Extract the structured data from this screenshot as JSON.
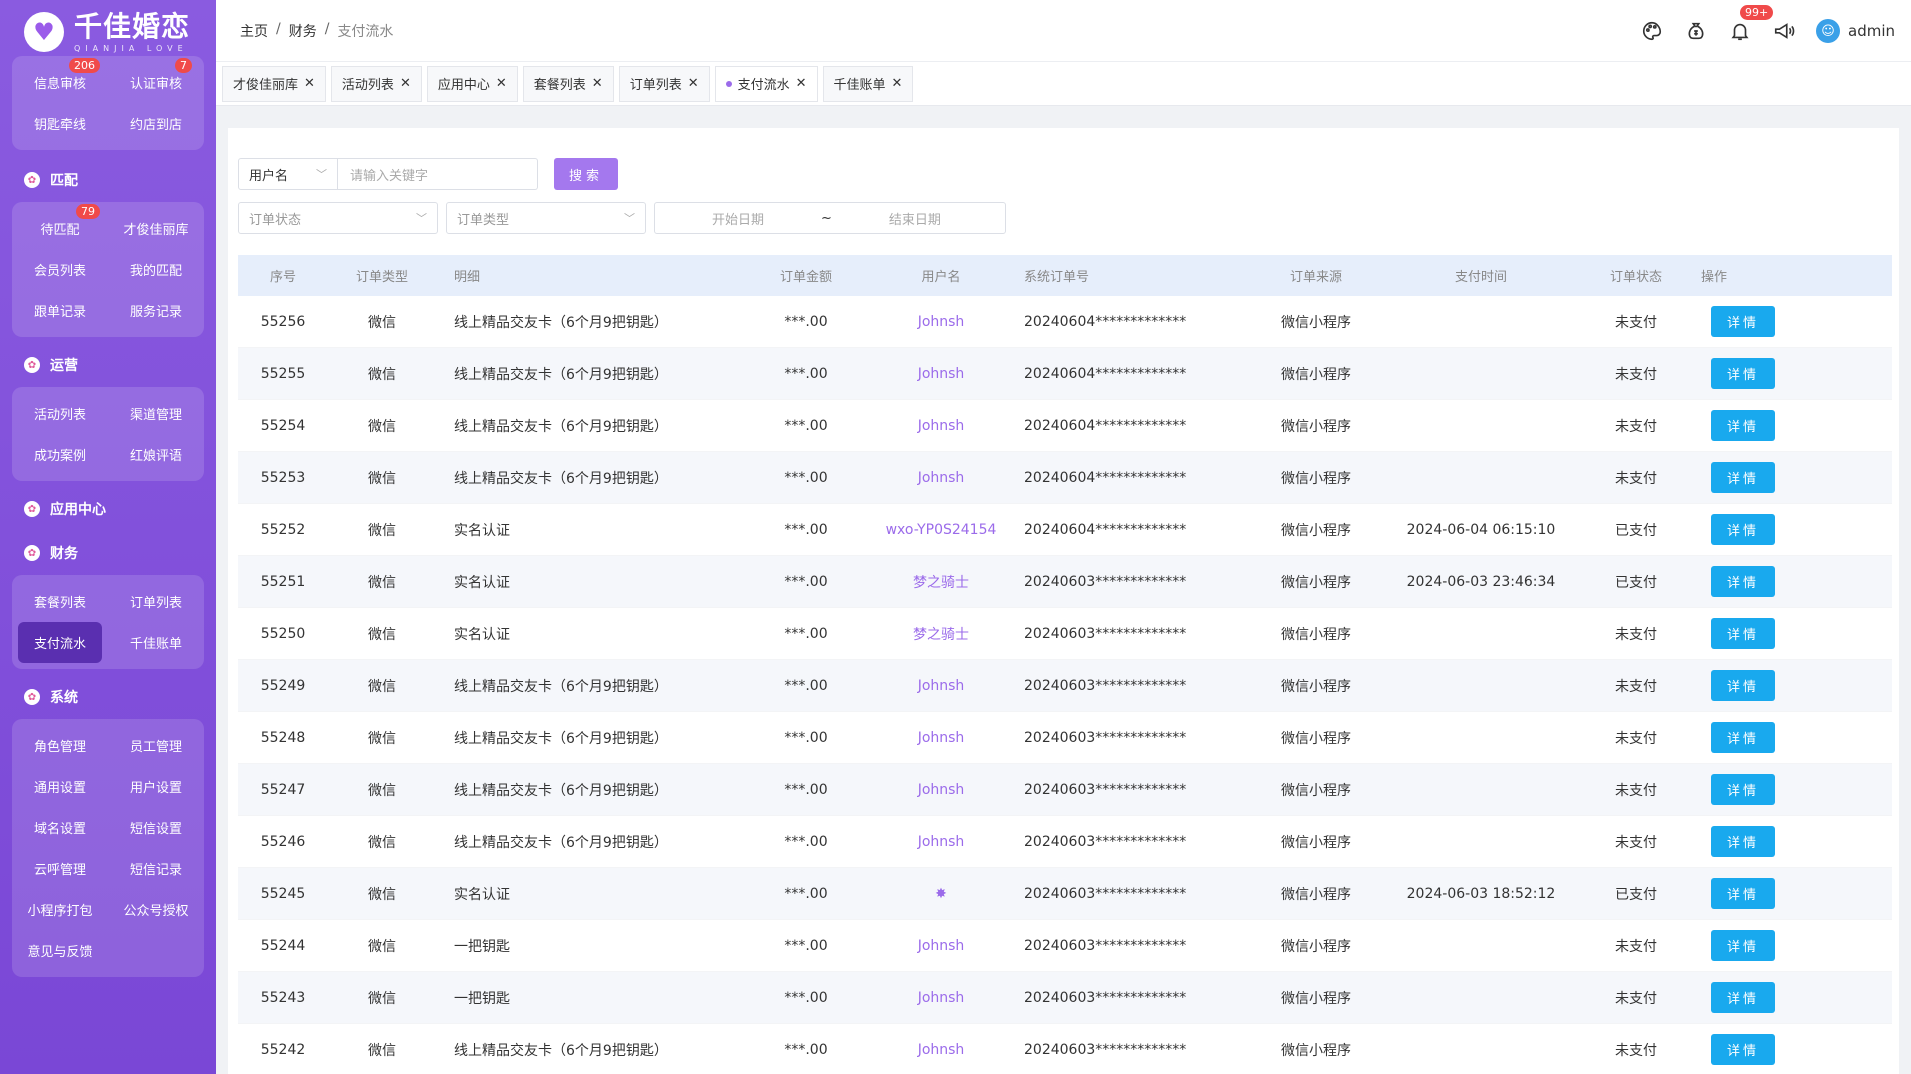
{
  "brand": {
    "name": "千佳婚恋",
    "sub": "QIANJIA LOVE"
  },
  "sidebar": {
    "top_group": [
      {
        "label": "信息审核",
        "badge": "206"
      },
      {
        "label": "认证审核",
        "badge": "7"
      },
      {
        "label": "钥匙牵线",
        "badge": ""
      },
      {
        "label": "约店到店",
        "badge": ""
      }
    ],
    "sections": [
      {
        "title": "匹配",
        "items": [
          {
            "label": "待匹配",
            "badge": "79"
          },
          {
            "label": "才俊佳丽库",
            "badge": ""
          },
          {
            "label": "会员列表",
            "badge": ""
          },
          {
            "label": "我的匹配",
            "badge": ""
          },
          {
            "label": "跟单记录",
            "badge": ""
          },
          {
            "label": "服务记录",
            "badge": ""
          }
        ]
      },
      {
        "title": "运营",
        "items": [
          {
            "label": "活动列表",
            "badge": ""
          },
          {
            "label": "渠道管理",
            "badge": ""
          },
          {
            "label": "成功案例",
            "badge": ""
          },
          {
            "label": "红娘评语",
            "badge": ""
          }
        ]
      },
      {
        "title": "应用中心",
        "items": []
      },
      {
        "title": "财务",
        "items": [
          {
            "label": "套餐列表",
            "badge": ""
          },
          {
            "label": "订单列表",
            "badge": ""
          },
          {
            "label": "支付流水",
            "badge": "",
            "active": true
          },
          {
            "label": "千佳账单",
            "badge": ""
          }
        ]
      },
      {
        "title": "系统",
        "items": [
          {
            "label": "角色管理",
            "badge": ""
          },
          {
            "label": "员工管理",
            "badge": ""
          },
          {
            "label": "通用设置",
            "badge": ""
          },
          {
            "label": "用户设置",
            "badge": ""
          },
          {
            "label": "域名设置",
            "badge": ""
          },
          {
            "label": "短信设置",
            "badge": ""
          },
          {
            "label": "云呼管理",
            "badge": ""
          },
          {
            "label": "短信记录",
            "badge": ""
          },
          {
            "label": "小程序打包",
            "badge": ""
          },
          {
            "label": "公众号授权",
            "badge": ""
          },
          {
            "label": "意见与反馈",
            "badge": ""
          }
        ]
      }
    ]
  },
  "header": {
    "breadcrumb": [
      "主页",
      "财务",
      "支付流水"
    ],
    "bell_badge": "99+",
    "user": "admin"
  },
  "tabs": [
    {
      "label": "才俊佳丽库",
      "active": false
    },
    {
      "label": "活动列表",
      "active": false
    },
    {
      "label": "应用中心",
      "active": false
    },
    {
      "label": "套餐列表",
      "active": false
    },
    {
      "label": "订单列表",
      "active": false
    },
    {
      "label": "支付流水",
      "active": true
    },
    {
      "label": "千佳账单",
      "active": false
    }
  ],
  "filters": {
    "field_select": "用户名",
    "keyword_placeholder": "请输入关键字",
    "search_label": "搜索",
    "status_placeholder": "订单状态",
    "type_placeholder": "订单类型",
    "start_date": "开始日期",
    "date_sep": "~",
    "end_date": "结束日期"
  },
  "table": {
    "columns": [
      "序号",
      "订单类型",
      "明细",
      "订单金额",
      "用户名",
      "系统订单号",
      "订单来源",
      "支付时间",
      "订单状态",
      "操作"
    ],
    "detail_button": "详情",
    "rows": [
      {
        "id": "55256",
        "type": "微信",
        "detail": "线上精品交友卡（6个月9把钥匙）",
        "amount": "***.00",
        "user": "Johnsh",
        "order_no": "20240604*************",
        "source": "微信小程序",
        "paid_at": "",
        "status": "未支付"
      },
      {
        "id": "55255",
        "type": "微信",
        "detail": "线上精品交友卡（6个月9把钥匙）",
        "amount": "***.00",
        "user": "Johnsh",
        "order_no": "20240604*************",
        "source": "微信小程序",
        "paid_at": "",
        "status": "未支付"
      },
      {
        "id": "55254",
        "type": "微信",
        "detail": "线上精品交友卡（6个月9把钥匙）",
        "amount": "***.00",
        "user": "Johnsh",
        "order_no": "20240604*************",
        "source": "微信小程序",
        "paid_at": "",
        "status": "未支付"
      },
      {
        "id": "55253",
        "type": "微信",
        "detail": "线上精品交友卡（6个月9把钥匙）",
        "amount": "***.00",
        "user": "Johnsh",
        "order_no": "20240604*************",
        "source": "微信小程序",
        "paid_at": "",
        "status": "未支付"
      },
      {
        "id": "55252",
        "type": "微信",
        "detail": "实名认证",
        "amount": "***.00",
        "user": "wxo-YP0S24154",
        "order_no": "20240604*************",
        "source": "微信小程序",
        "paid_at": "2024-06-04 06:15:10",
        "status": "已支付"
      },
      {
        "id": "55251",
        "type": "微信",
        "detail": "实名认证",
        "amount": "***.00",
        "user": "梦之骑士",
        "order_no": "20240603*************",
        "source": "微信小程序",
        "paid_at": "2024-06-03 23:46:34",
        "status": "已支付"
      },
      {
        "id": "55250",
        "type": "微信",
        "detail": "实名认证",
        "amount": "***.00",
        "user": "梦之骑士",
        "order_no": "20240603*************",
        "source": "微信小程序",
        "paid_at": "",
        "status": "未支付"
      },
      {
        "id": "55249",
        "type": "微信",
        "detail": "线上精品交友卡（6个月9把钥匙）",
        "amount": "***.00",
        "user": "Johnsh",
        "order_no": "20240603*************",
        "source": "微信小程序",
        "paid_at": "",
        "status": "未支付"
      },
      {
        "id": "55248",
        "type": "微信",
        "detail": "线上精品交友卡（6个月9把钥匙）",
        "amount": "***.00",
        "user": "Johnsh",
        "order_no": "20240603*************",
        "source": "微信小程序",
        "paid_at": "",
        "status": "未支付"
      },
      {
        "id": "55247",
        "type": "微信",
        "detail": "线上精品交友卡（6个月9把钥匙）",
        "amount": "***.00",
        "user": "Johnsh",
        "order_no": "20240603*************",
        "source": "微信小程序",
        "paid_at": "",
        "status": "未支付"
      },
      {
        "id": "55246",
        "type": "微信",
        "detail": "线上精品交友卡（6个月9把钥匙）",
        "amount": "***.00",
        "user": "Johnsh",
        "order_no": "20240603*************",
        "source": "微信小程序",
        "paid_at": "",
        "status": "未支付"
      },
      {
        "id": "55245",
        "type": "微信",
        "detail": "实名认证",
        "amount": "***.00",
        "user": "✸",
        "order_no": "20240603*************",
        "source": "微信小程序",
        "paid_at": "2024-06-03 18:52:12",
        "status": "已支付"
      },
      {
        "id": "55244",
        "type": "微信",
        "detail": "一把钥匙",
        "amount": "***.00",
        "user": "Johnsh",
        "order_no": "20240603*************",
        "source": "微信小程序",
        "paid_at": "",
        "status": "未支付"
      },
      {
        "id": "55243",
        "type": "微信",
        "detail": "一把钥匙",
        "amount": "***.00",
        "user": "Johnsh",
        "order_no": "20240603*************",
        "source": "微信小程序",
        "paid_at": "",
        "status": "未支付"
      },
      {
        "id": "55242",
        "type": "微信",
        "detail": "线上精品交友卡（6个月9把钥匙）",
        "amount": "***.00",
        "user": "Johnsh",
        "order_no": "20240603*************",
        "source": "微信小程序",
        "paid_at": "",
        "status": "未支付"
      }
    ]
  }
}
